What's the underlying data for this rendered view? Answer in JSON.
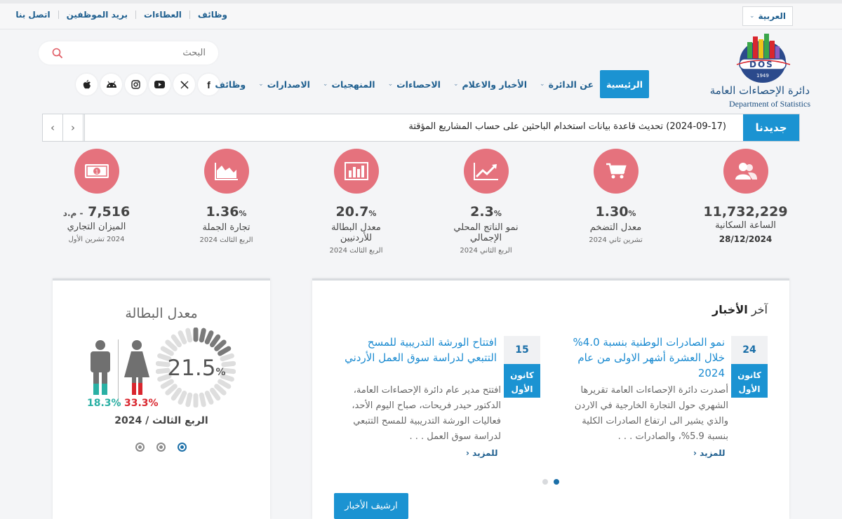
{
  "topbar": {
    "links": [
      "اتصل بنا",
      "بريد الموظفين",
      "العطاءات",
      "وظائف"
    ],
    "language": "العربية"
  },
  "search": {
    "placeholder": "البحث"
  },
  "logo": {
    "badge_text": "DOS",
    "year": "1949",
    "name_ar": "دائرة الإحصاءات العامة",
    "name_en": "Department of Statistics"
  },
  "social": [
    "facebook-icon",
    "x-icon",
    "youtube-icon",
    "instagram-icon",
    "android-icon",
    "apple-icon"
  ],
  "nav": {
    "items": [
      {
        "label": "الرئيسية",
        "active": true,
        "dropdown": false
      },
      {
        "label": "عن الدائرة",
        "active": false,
        "dropdown": true
      },
      {
        "label": "الأخبار والاعلام",
        "active": false,
        "dropdown": true
      },
      {
        "label": "الاحصاءات",
        "active": false,
        "dropdown": true
      },
      {
        "label": "المنهجيات",
        "active": false,
        "dropdown": true
      },
      {
        "label": "الاصدارات",
        "active": false,
        "dropdown": true
      },
      {
        "label": "وظائف",
        "active": false,
        "dropdown": false
      }
    ]
  },
  "ticker": {
    "label": "جديدنا",
    "text": "(2024-09-17) تحديث قاعدة بيانات استخدام الباحثين على حساب المشاريع المؤقتة"
  },
  "stats": [
    {
      "icon": "population-icon",
      "value": "11,732,229",
      "suffix": "",
      "label": "الساعة السكانية",
      "sub": "28/12/2024"
    },
    {
      "icon": "cart-icon",
      "value": "1.30",
      "suffix": "%",
      "label": "معدل التضخم",
      "sub": "تشرين ثاني 2024"
    },
    {
      "icon": "growth-chart-icon",
      "value": "2.3",
      "suffix": "%",
      "label": "نمو الناتج المحلي الإجمالي",
      "sub": "الربع الثاني 2024"
    },
    {
      "icon": "bar-chart-icon",
      "value": "20.7",
      "suffix": "%",
      "label": "معدل البطالة للأردنيين",
      "sub": "الربع الثالث 2024"
    },
    {
      "icon": "area-chart-icon",
      "value": "1.36",
      "suffix": "%",
      "label": "تجارة الجملة",
      "sub": "الربع الثالث 2024"
    },
    {
      "icon": "money-icon",
      "value": "7,516",
      "suffix": "- م.د",
      "label": "الميزان التجاري",
      "sub": "2024 تشرين الأول"
    }
  ],
  "news": {
    "title_prefix": "آخر",
    "title_bold": "الأخبار",
    "items": [
      {
        "day": "24",
        "month": "كانون الأول",
        "title": "نمو الصادرات الوطنية بنسبة 4.0% خلال العشرة أشهر الاولى من عام 2024",
        "body": "أصدرت دائرة الإحصاءات العامة تقريرها الشهري حول التجارة الخارجية في الاردن والذي يشير الى ارتفاع الصادرات الكلية بنسبة 5.9%، والصادرات . . .",
        "more": "للمزيد"
      },
      {
        "day": "15",
        "month": "كانون الأول",
        "title": "افتتاح الورشة التدريبية للمسح التتبعي لدراسة سوق العمل الأردني",
        "body": "افتتح مدير عام دائرة الإحصاءات العامة، الدكتور حيدر فريحات، صباح اليوم الأحد، فعاليات الورشة التدريبية للمسح التتبعي لدراسة سوق العمل . . .",
        "more": "للمزيد"
      }
    ],
    "archive_label": "ارشيف الأخبار"
  },
  "unemployment": {
    "title": "معدل البطالة",
    "total": "21.5",
    "male_rate": "18.3%",
    "female_rate": "33.3%",
    "period": "الربع الثالث / 2024",
    "colors": {
      "male": "#2ab0a4",
      "female": "#d9262e"
    }
  }
}
